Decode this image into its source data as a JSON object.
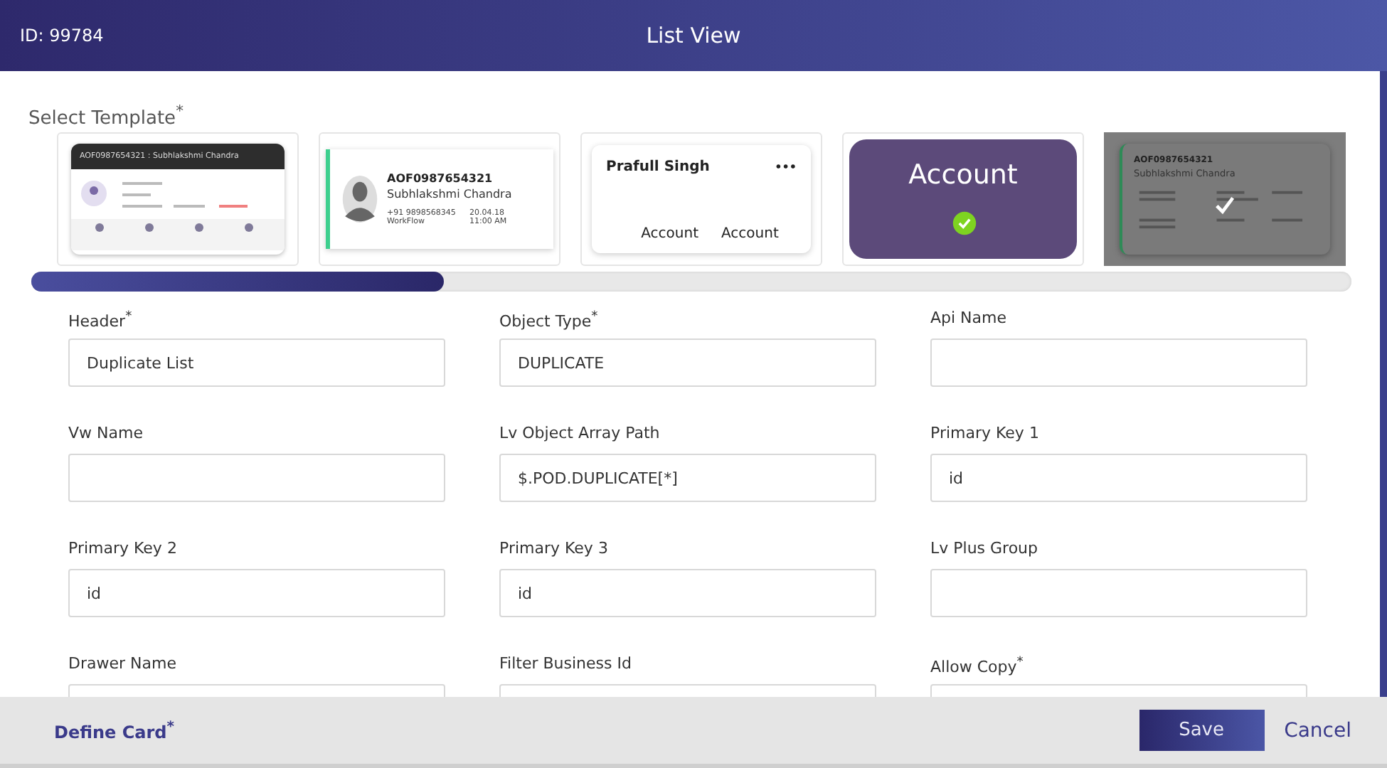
{
  "header": {
    "id_label": "ID: 99784",
    "title": "List View"
  },
  "template_label": "Select Template$^{*}$",
  "templates": [
    {
      "kind": "banner",
      "selected": false,
      "dimmed": false,
      "texts": [
        "AOF0987654321 :  Subhlakshmi Chandra"
      ]
    },
    {
      "kind": "contact",
      "selected": false,
      "dimmed": false,
      "texts": [
        "AOF0987654321",
        "Subhlakshmi Chandra",
        "+91 9898568345",
        "20.04.18",
        "WorkFlow",
        "11:00 AM"
      ]
    },
    {
      "kind": "simple",
      "selected": false,
      "dimmed": false,
      "texts": [
        "Prafull Singh",
        "•••",
        "Account",
        "Account"
      ]
    },
    {
      "kind": "tile",
      "selected": true,
      "dimmed": false,
      "texts": [
        "Account"
      ]
    },
    {
      "kind": "contact-mini",
      "selected": false,
      "dimmed": true,
      "texts": [
        "AOF0987654321",
        "Subhlakshmi Chandra"
      ]
    }
  ],
  "fields": [
    {
      "label": "Header$^{*}$",
      "value": "Duplicate List"
    },
    {
      "label": "Object Type$^{*}$",
      "value": "DUPLICATE"
    },
    {
      "label": "Api Name"
    },
    {
      "label": "Vw Name"
    },
    {
      "label": "Lv Object Array Path",
      "value": "$.POD.DUPLICATE[*]"
    },
    {
      "label": "Primary Key 1",
      "value": "id"
    },
    {
      "label": "Primary Key 2",
      "value": "id"
    },
    {
      "label": "Primary Key 3",
      "value": "id"
    },
    {
      "label": "Lv Plus Group"
    },
    {
      "label": "Drawer Name"
    },
    {
      "label": "Filter Business Id"
    },
    {
      "label": "Allow Copy$^{*}$"
    }
  ],
  "footer": {
    "link": "Define Card$^{*}$",
    "buttons": [
      "Save",
      "Cancel"
    ]
  }
}
